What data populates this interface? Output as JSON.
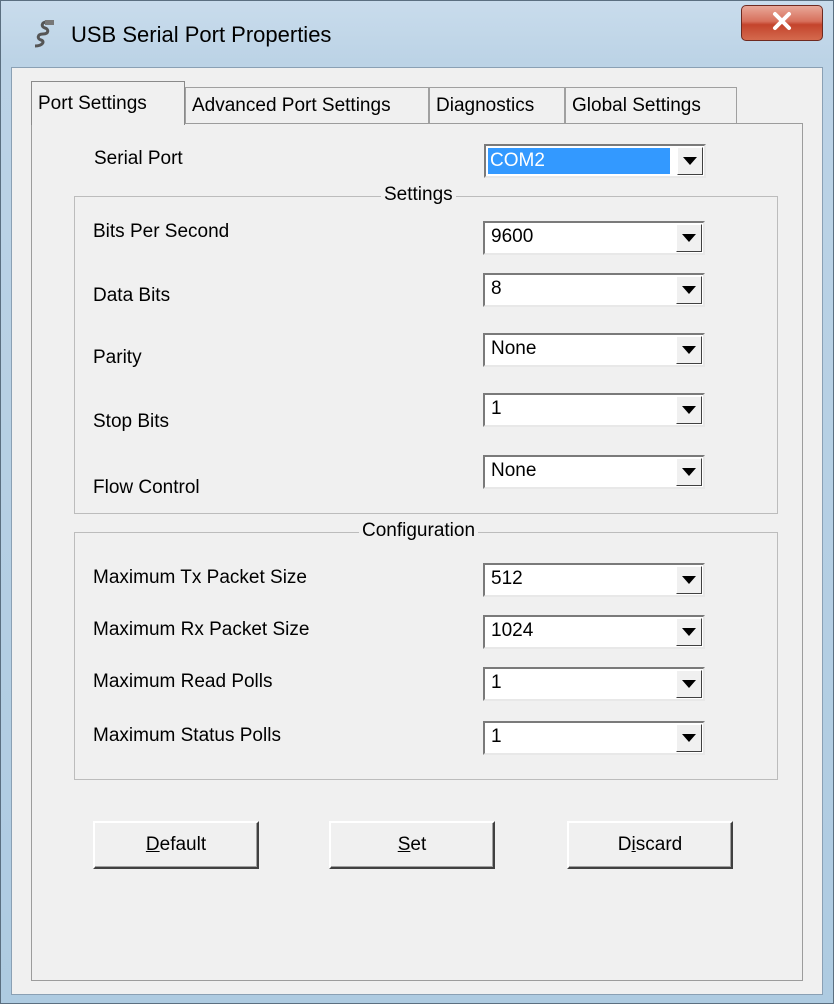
{
  "window": {
    "title": "USB Serial Port Properties",
    "close_label": "X"
  },
  "tabs": [
    {
      "label": "Port Settings",
      "active": true
    },
    {
      "label": "Advanced Port Settings"
    },
    {
      "label": "Diagnostics"
    },
    {
      "label": "Global Settings"
    }
  ],
  "serial_port": {
    "label": "Serial Port",
    "value": "COM2"
  },
  "settings": {
    "legend": "Settings",
    "fields": [
      {
        "label": "Bits Per Second",
        "value": "9600"
      },
      {
        "label": "Data Bits",
        "value": "8"
      },
      {
        "label": "Parity",
        "value": "None"
      },
      {
        "label": "Stop Bits",
        "value": "1"
      },
      {
        "label": "Flow Control",
        "value": "None"
      }
    ]
  },
  "configuration": {
    "legend": "Configuration",
    "fields": [
      {
        "label": "Maximum Tx Packet Size",
        "value": "512"
      },
      {
        "label": "Maximum Rx Packet Size",
        "value": "1024"
      },
      {
        "label": "Maximum Read Polls",
        "value": "1"
      },
      {
        "label": "Maximum Status Polls",
        "value": "1"
      }
    ]
  },
  "buttons": {
    "default": {
      "label": "Default",
      "accesskey": "D"
    },
    "set": {
      "label": "Set",
      "accesskey": "S"
    },
    "discard": {
      "label": "Discard",
      "accesskey": "i"
    }
  },
  "colors": {
    "selection": "#3399ff",
    "close_button": "#c4442c",
    "frame": "#bcd3e6"
  }
}
